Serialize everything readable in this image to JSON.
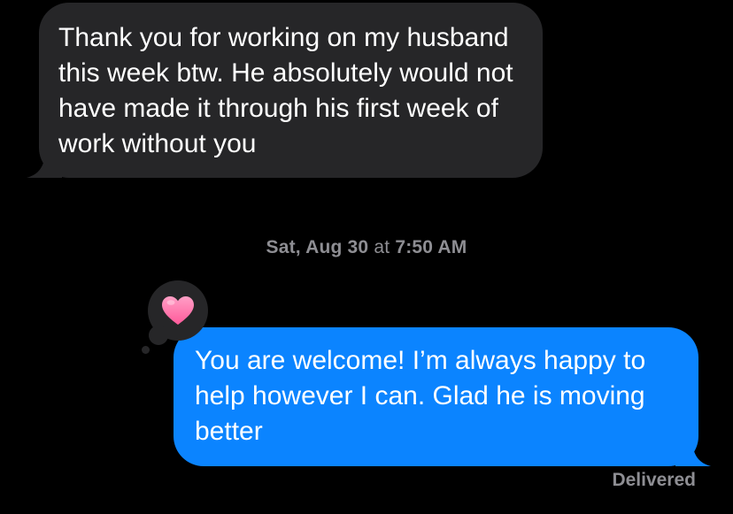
{
  "colors": {
    "background": "#000000",
    "incoming_bubble": "#262628",
    "outgoing_bubble": "#0b84ff",
    "meta_text": "#8e8e93",
    "heart": "#ff6fa8"
  },
  "messages": [
    {
      "direction": "incoming",
      "text": "Thank you for working on my husband this week btw. He absolutely would not have made it through his first week of work without you"
    },
    {
      "direction": "outgoing",
      "text": "You are welcome! I’m always happy to help however I can. Glad he is moving better",
      "reaction": {
        "icon": "heart-icon",
        "emoji": "🩷"
      },
      "status": "Delivered"
    }
  ],
  "timestamp": {
    "day": "Sat, Aug 30",
    "separator": "at",
    "time": "7:50 AM"
  }
}
